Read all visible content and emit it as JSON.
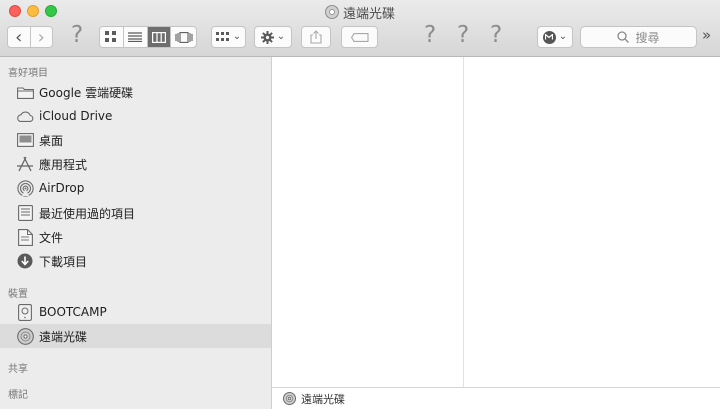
{
  "window": {
    "title": "遠端光碟"
  },
  "toolbar": {
    "back_glyph": "‹",
    "forward_glyph": "›",
    "help_glyph": "?",
    "search_placeholder": "搜尋",
    "overflow_glyph": "»",
    "disclosure_glyph": "⌄"
  },
  "sidebar": {
    "favorites_header": "喜好項目",
    "devices_header": "裝置",
    "shared_header": "共享",
    "tags_header": "標記",
    "favorites": [
      {
        "label": "Google 雲端硬碟",
        "icon": "folder-icon"
      },
      {
        "label": "iCloud Drive",
        "icon": "cloud-icon"
      },
      {
        "label": "桌面",
        "icon": "desktop-icon"
      },
      {
        "label": "應用程式",
        "icon": "applications-icon"
      },
      {
        "label": "AirDrop",
        "icon": "airdrop-icon"
      },
      {
        "label": "最近使用過的項目",
        "icon": "recents-icon"
      },
      {
        "label": "文件",
        "icon": "documents-icon"
      },
      {
        "label": "下載項目",
        "icon": "downloads-icon"
      }
    ],
    "devices": [
      {
        "label": "BOOTCAMP",
        "icon": "drive-icon"
      },
      {
        "label": "遠端光碟",
        "icon": "disc-icon",
        "selected": true
      }
    ]
  },
  "pathbar": {
    "label": "遠端光碟"
  }
}
